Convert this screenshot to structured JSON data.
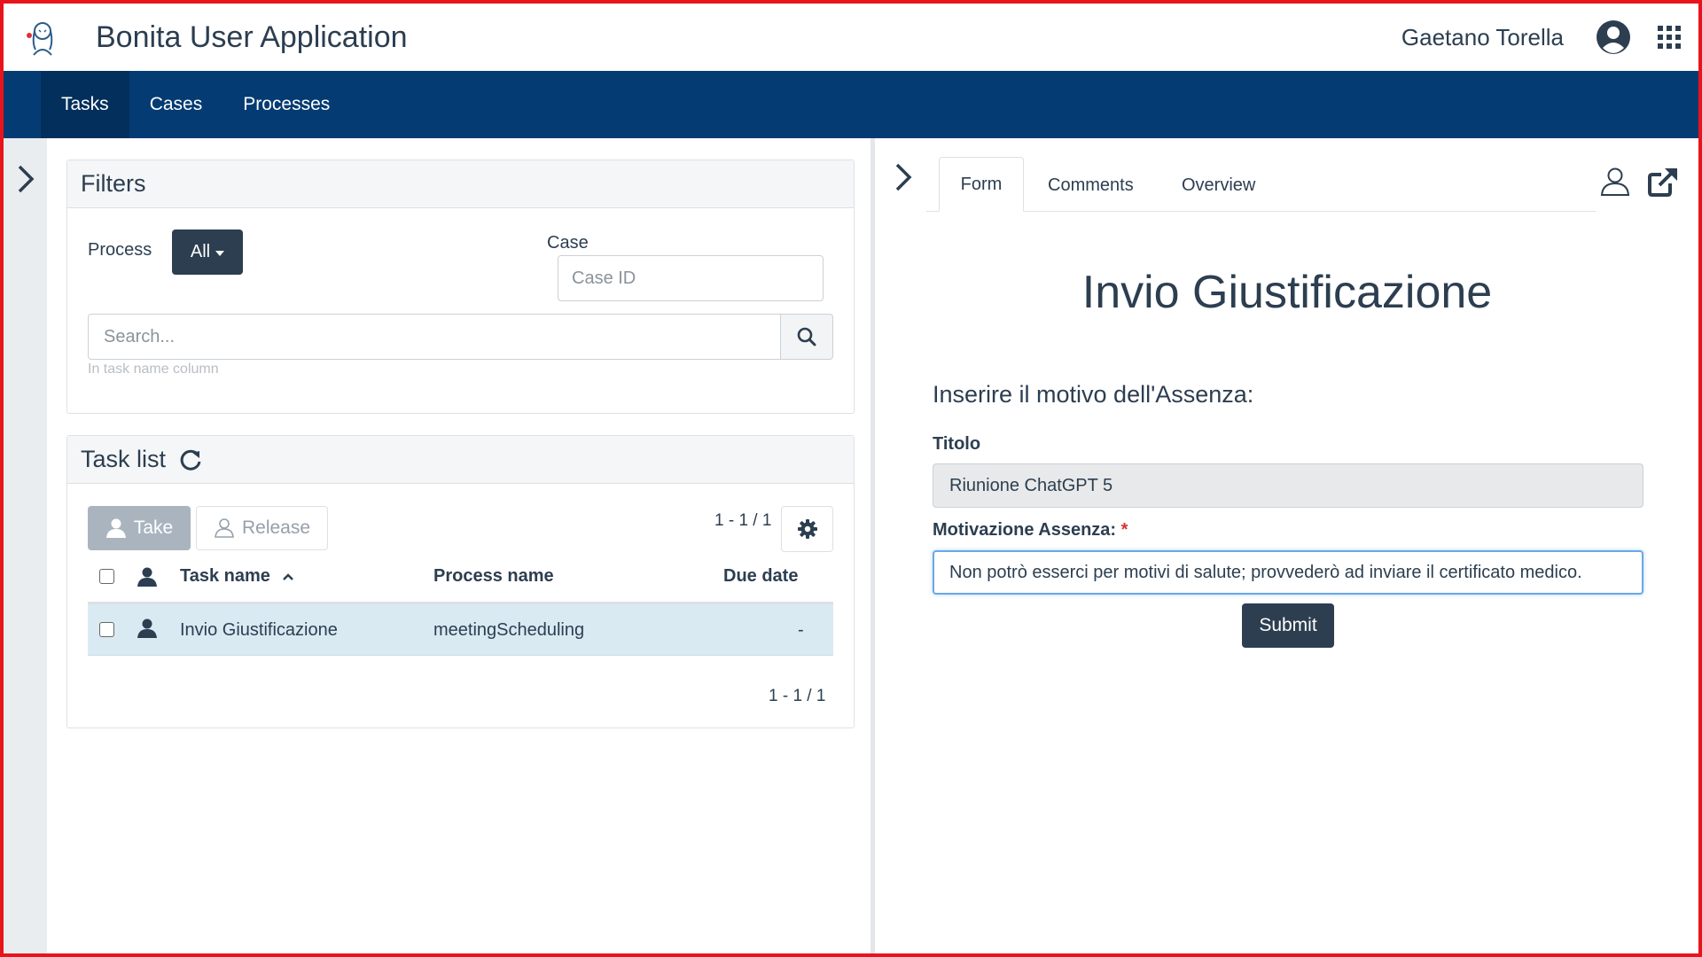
{
  "header": {
    "app_title": "Bonita User Application",
    "user_name": "Gaetano Torella"
  },
  "nav": {
    "tabs": [
      {
        "label": "Tasks",
        "active": true
      },
      {
        "label": "Cases",
        "active": false
      },
      {
        "label": "Processes",
        "active": false
      }
    ]
  },
  "filters": {
    "title": "Filters",
    "process_label": "Process",
    "process_value": "All",
    "case_label": "Case",
    "case_placeholder": "Case ID",
    "search_placeholder": "Search...",
    "search_hint": "In task name column"
  },
  "task_list": {
    "title": "Task list",
    "take_label": "Take",
    "release_label": "Release",
    "pager_top": "1 - 1 / 1",
    "pager_bottom": "1 - 1 / 1",
    "columns": [
      "Task name",
      "Process name",
      "Due date"
    ],
    "rows": [
      {
        "task_name": "Invio Giustificazione",
        "process_name": "meetingScheduling",
        "due_date": "-"
      }
    ]
  },
  "detail": {
    "tabs": [
      {
        "label": "Form",
        "active": true
      },
      {
        "label": "Comments",
        "active": false
      },
      {
        "label": "Overview",
        "active": false
      }
    ],
    "form": {
      "title": "Invio Giustificazione",
      "subtitle": "Inserire il motivo dell'Assenza:",
      "titolo_label": "Titolo",
      "titolo_value": "Riunione ChatGPT 5",
      "motivazione_label": "Motivazione Assenza:",
      "required_mark": "*",
      "motivazione_value": "Non potrò esserci per motivi di salute; provvederò ad inviare il certificato medico.",
      "submit_label": "Submit"
    }
  },
  "colors": {
    "navbar": "#043b72",
    "primary_button": "#2c3e50",
    "selected_row": "#d9eaf3",
    "frame_border": "#e8141c"
  },
  "icons": [
    "bonita-logo",
    "user-circle-icon",
    "apps-grid-icon",
    "chevron-right-icon",
    "search-icon",
    "refresh-icon",
    "user-icon",
    "user-outline-icon",
    "gear-icon",
    "sort-up-icon",
    "external-link-icon"
  ]
}
